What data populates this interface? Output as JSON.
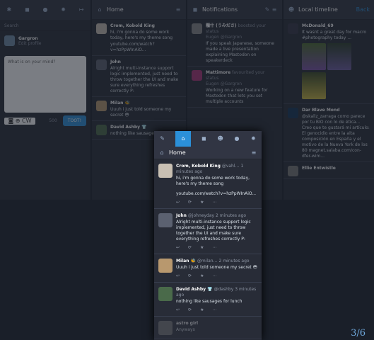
{
  "colors": {
    "bg": "#1a1f29",
    "column": "#282c37",
    "header": "#313543",
    "accent": "#2b90d9"
  },
  "compose_column": {
    "search_placeholder": "Search",
    "user": {
      "name": "Gargron",
      "edit": "Edit profile"
    },
    "textarea_placeholder": "What is on your mind?",
    "cw_label": "CW",
    "counter": "500",
    "toot_button": "TOOT!"
  },
  "home_column": {
    "title": "Home"
  },
  "notifications_column": {
    "title": "Notifications",
    "items": [
      {
        "actor": "鿠什 (うみださ)",
        "action": "boosted your status",
        "author": "Eugen @Gargron",
        "time": "6 hours ago",
        "text": "If you speak Japanese, someone made a live presentation explaining Mastodon on speakerdeck"
      },
      {
        "actor": "Mattimore",
        "action": "favourited your status",
        "author": "Eugen @Gargron",
        "time": "3 hours ago",
        "text": "Working on a new feature for Mastodon that lets you set multiple accounts"
      }
    ]
  },
  "local_column": {
    "title": "Local timeline",
    "back": "Back",
    "items": [
      {
        "name": "McDonald_69",
        "time": "5 minutes ago",
        "text": "It wasnt a great day for macro #photography today ..."
      },
      {
        "name": "Dar Blave Mond",
        "time": "3 minutes ago",
        "text": "@skallz_zarraga como parece por tu BIO con lo de ética... Creo que te gustará mi artículo: El genocidio entre la alta composición en España y el motivo de la Nueva York de los 80 magnet.salaba.com/con-dfer-wim..."
      },
      {
        "name": "Ellie Entwistle",
        "time": "6 minutes ago",
        "text": ""
      }
    ]
  },
  "front": {
    "title": "Home",
    "statuses": [
      {
        "name": "Crom, Kobold King",
        "handle": "@vahl…",
        "time": "1 minutes ago",
        "text": "hi, i'm gonna do some work today, here's my theme song",
        "link": "youtube.com/watch?v=hzPpWInAiO..."
      },
      {
        "name": "John⁠⁠⁠⁠",
        "handle": "@johneyday",
        "time": "2 minutes ago",
        "text": "Alright multi-instance support logic implemented, just need to throw together the UI and make sure everything refreshes correctly P:"
      },
      {
        "name": "Milan 🐝",
        "handle": "@milan…",
        "time": "2 minutes ago",
        "text": "Uuuh i just told someone my secret 😳"
      },
      {
        "name": "David Ashby 👕",
        "handle": "@dashby",
        "time": "3 minutes ago",
        "text": "nothing like sausages for lunch"
      },
      {
        "name": "astro girl",
        "handle": "",
        "time": "",
        "text": "Anyways"
      }
    ]
  },
  "pager": "3/6"
}
